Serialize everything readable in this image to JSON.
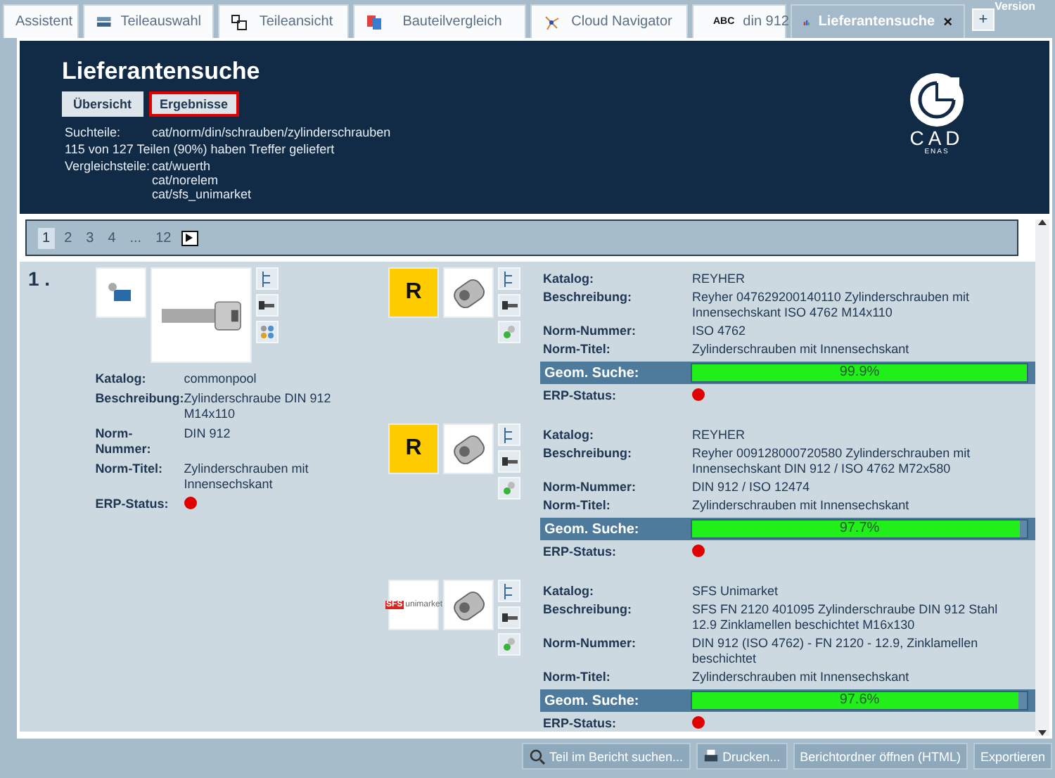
{
  "corner_text": "Version",
  "tabs": [
    {
      "label": "Assistent",
      "selected": false
    },
    {
      "label": "Teileauswahl",
      "selected": false
    },
    {
      "label": "Teileansicht",
      "selected": false
    },
    {
      "label": "Bauteilvergleich",
      "selected": false
    },
    {
      "label": "Cloud Navigator",
      "selected": false
    },
    {
      "label": "din 912",
      "icon_text": "ABC",
      "selected": false
    },
    {
      "label": "Lieferantensuche",
      "selected": true
    }
  ],
  "tab_close": "×",
  "tab_add": "+",
  "header": {
    "title": "Lieferantensuche",
    "buttons": [
      {
        "label": "Übersicht",
        "selected": false
      },
      {
        "label": "Ergebnisse",
        "selected": true
      }
    ],
    "rows": [
      {
        "label": "Suchteile:",
        "values": [
          "cat/norm/din/schrauben/zylinderschrauben"
        ]
      },
      {
        "label": "115 von 127 Teilen (90%) haben Treffer geliefert",
        "values": []
      },
      {
        "label": "Vergleichsteile:",
        "values": [
          "cat/wuerth",
          "cat/norelem",
          "cat/sfs_unimarket"
        ]
      }
    ],
    "logo": {
      "text": "CAD",
      "subtext": "ENAS"
    }
  },
  "pager": {
    "pages": [
      {
        "label": "1",
        "selected": true
      },
      {
        "label": "2",
        "selected": false
      },
      {
        "label": "3",
        "selected": false
      },
      {
        "label": "4",
        "selected": false
      },
      {
        "label": "...",
        "selected": false
      },
      {
        "label": "12",
        "selected": false
      }
    ]
  },
  "result": {
    "number": "1 .",
    "source": {
      "fields": [
        {
          "label": "Katalog:",
          "value": "commonpool"
        },
        {
          "label": "Beschreibung:",
          "value": "Zylinderschraube DIN 912 M14x110"
        },
        {
          "label": "Norm-Nummer:",
          "value": "DIN 912"
        },
        {
          "label": "Norm-Titel:",
          "value": "Zylinderschrauben mit Innensechskant"
        }
      ],
      "erp_label": "ERP-Status:",
      "erp_ok": false
    },
    "matches": [
      {
        "kind": "block",
        "logo_text": "R",
        "fields": [
          {
            "label": "Katalog:",
            "value": "REYHER"
          },
          {
            "label": "Beschreibung:",
            "value": "Reyher 047629200140110 Zylinderschrauben mit Innensechskant ISO 4762 M14x110"
          },
          {
            "label": "Norm-Nummer:",
            "value": "ISO 4762"
          },
          {
            "label": "Norm-Titel:",
            "value": "Zylinderschrauben mit Innensechskant"
          }
        ],
        "geom_label": "Geom. Suche:",
        "level": 0.999,
        "reading": "99.9%",
        "erp_label": "ERP-Status:",
        "erp_ok": false
      },
      {
        "kind": "block",
        "logo_text": "R",
        "fields": [
          {
            "label": "Katalog:",
            "value": "REYHER"
          },
          {
            "label": "Beschreibung:",
            "value": "Reyher 009128000720580 Zylinderschrauben mit Innensechskant DIN 912 / ISO 4762 M72x580"
          },
          {
            "label": "Norm-Nummer:",
            "value": "DIN 912 / ISO 12474"
          },
          {
            "label": "Norm-Titel:",
            "value": "Zylinderschrauben mit Innensechskant"
          }
        ],
        "geom_label": "Geom. Suche:",
        "level": 0.977,
        "reading": "97.7%",
        "erp_label": "ERP-Status:",
        "erp_ok": false
      },
      {
        "kind": "wordmark",
        "logo_text": "SFS",
        "logo_subtext": "unimarket",
        "fields": [
          {
            "label": "Katalog:",
            "value": "SFS Unimarket"
          },
          {
            "label": "Beschreibung:",
            "value": "SFS FN 2120 401095 Zylinderschraube DIN 912 Stahl 12.9 Zinklamellen beschichtet M16x130"
          },
          {
            "label": "Norm-Nummer:",
            "value": "DIN 912 (ISO 4762) - FN 2120 - 12.9, Zinklamellen beschichtet"
          },
          {
            "label": "Norm-Titel:",
            "value": "Zylinderschrauben mit Innensechskant"
          }
        ],
        "geom_label": "Geom. Suche:",
        "level": 0.976,
        "reading": "97.6%",
        "erp_label": "ERP-Status:",
        "erp_ok": false
      }
    ]
  },
  "footer_buttons": [
    {
      "label": "Teil im Bericht suchen..."
    },
    {
      "label": "Drucken..."
    },
    {
      "label": "Berichtordner öffnen (HTML)"
    },
    {
      "label": "Exportieren"
    }
  ]
}
